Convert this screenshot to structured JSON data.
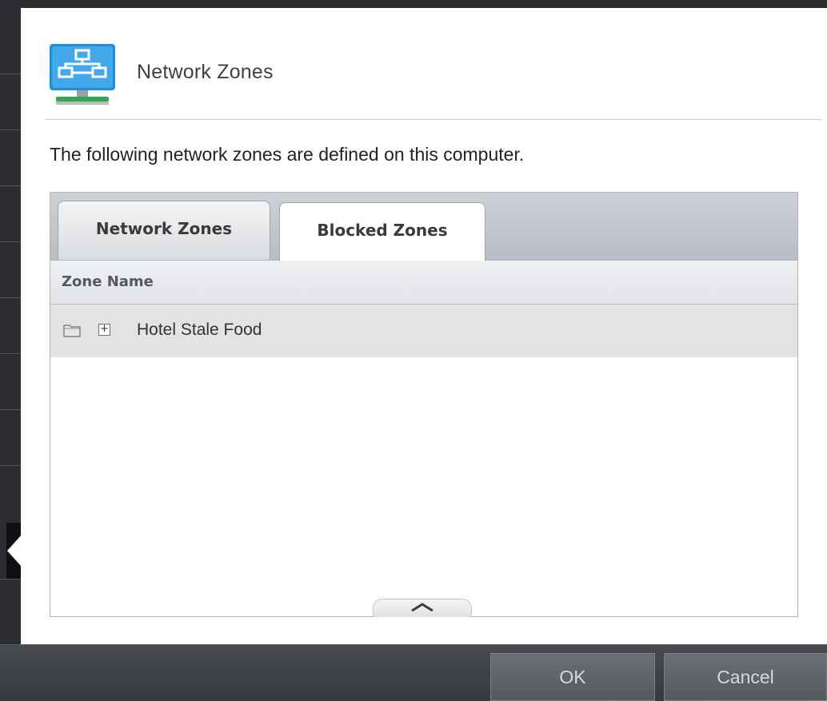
{
  "dialog": {
    "title": "Network Zones",
    "header_icon": "network-zones-icon",
    "description": "The following network zones are defined on this computer."
  },
  "tabs": [
    {
      "label": "Network Zones",
      "active": false
    },
    {
      "label": "Blocked Zones",
      "active": true
    }
  ],
  "table": {
    "columns": [
      "Zone Name"
    ],
    "rows": [
      {
        "name": "Hotel Stale Food",
        "icon": "folder-icon",
        "expander": "+"
      }
    ]
  },
  "footer": {
    "ok_label": "OK",
    "cancel_label": "Cancel"
  },
  "colors": {
    "accent_blue": "#1e8fd9",
    "accent_green": "#2fa84f",
    "footer_bg": "#3a3d41"
  }
}
